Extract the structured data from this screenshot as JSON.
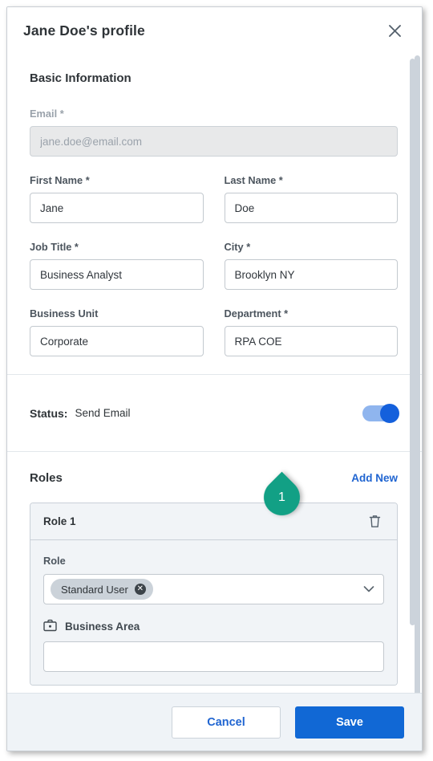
{
  "dialog": {
    "title": "Jane Doe's profile",
    "close_icon": "close-icon"
  },
  "basic_information": {
    "heading": "Basic Information",
    "fields": [
      {
        "label": "Email *",
        "value": "",
        "placeholder": "jane.doe@email.com",
        "disabled": true
      },
      {
        "label": "First Name *",
        "value": "Jane",
        "placeholder": ""
      },
      {
        "label": "Last Name *",
        "value": "Doe",
        "placeholder": ""
      },
      {
        "label": "Job Title *",
        "value": "Business Analyst",
        "placeholder": ""
      },
      {
        "label": "City *",
        "value": "Brooklyn NY",
        "placeholder": ""
      },
      {
        "label": "Business Unit",
        "value": "Corporate",
        "placeholder": ""
      },
      {
        "label": "Department *",
        "value": "RPA COE",
        "placeholder": ""
      }
    ]
  },
  "status": {
    "label": "Status:",
    "value": "Send Email",
    "toggle_on": true,
    "toggle_track_color": "#8fb5ee",
    "toggle_knob_color": "#1460dc"
  },
  "annotation": {
    "step_number": "1",
    "color": "#12a085"
  },
  "roles": {
    "heading": "Roles",
    "add_new_label": "Add New",
    "card": {
      "title": "Role 1",
      "delete_icon": "trash-icon",
      "role_label": "Role",
      "role_chip": "Standard User",
      "chip_remove_icon": "chip-remove-icon",
      "dropdown_icon": "chevron-down-icon",
      "business_area_label": "Business Area",
      "business_area_icon": "briefcase-icon",
      "business_area_value": ""
    }
  },
  "footer": {
    "cancel_label": "Cancel",
    "save_label": "Save",
    "save_color": "#1168d5",
    "link_color": "#2065d1"
  }
}
